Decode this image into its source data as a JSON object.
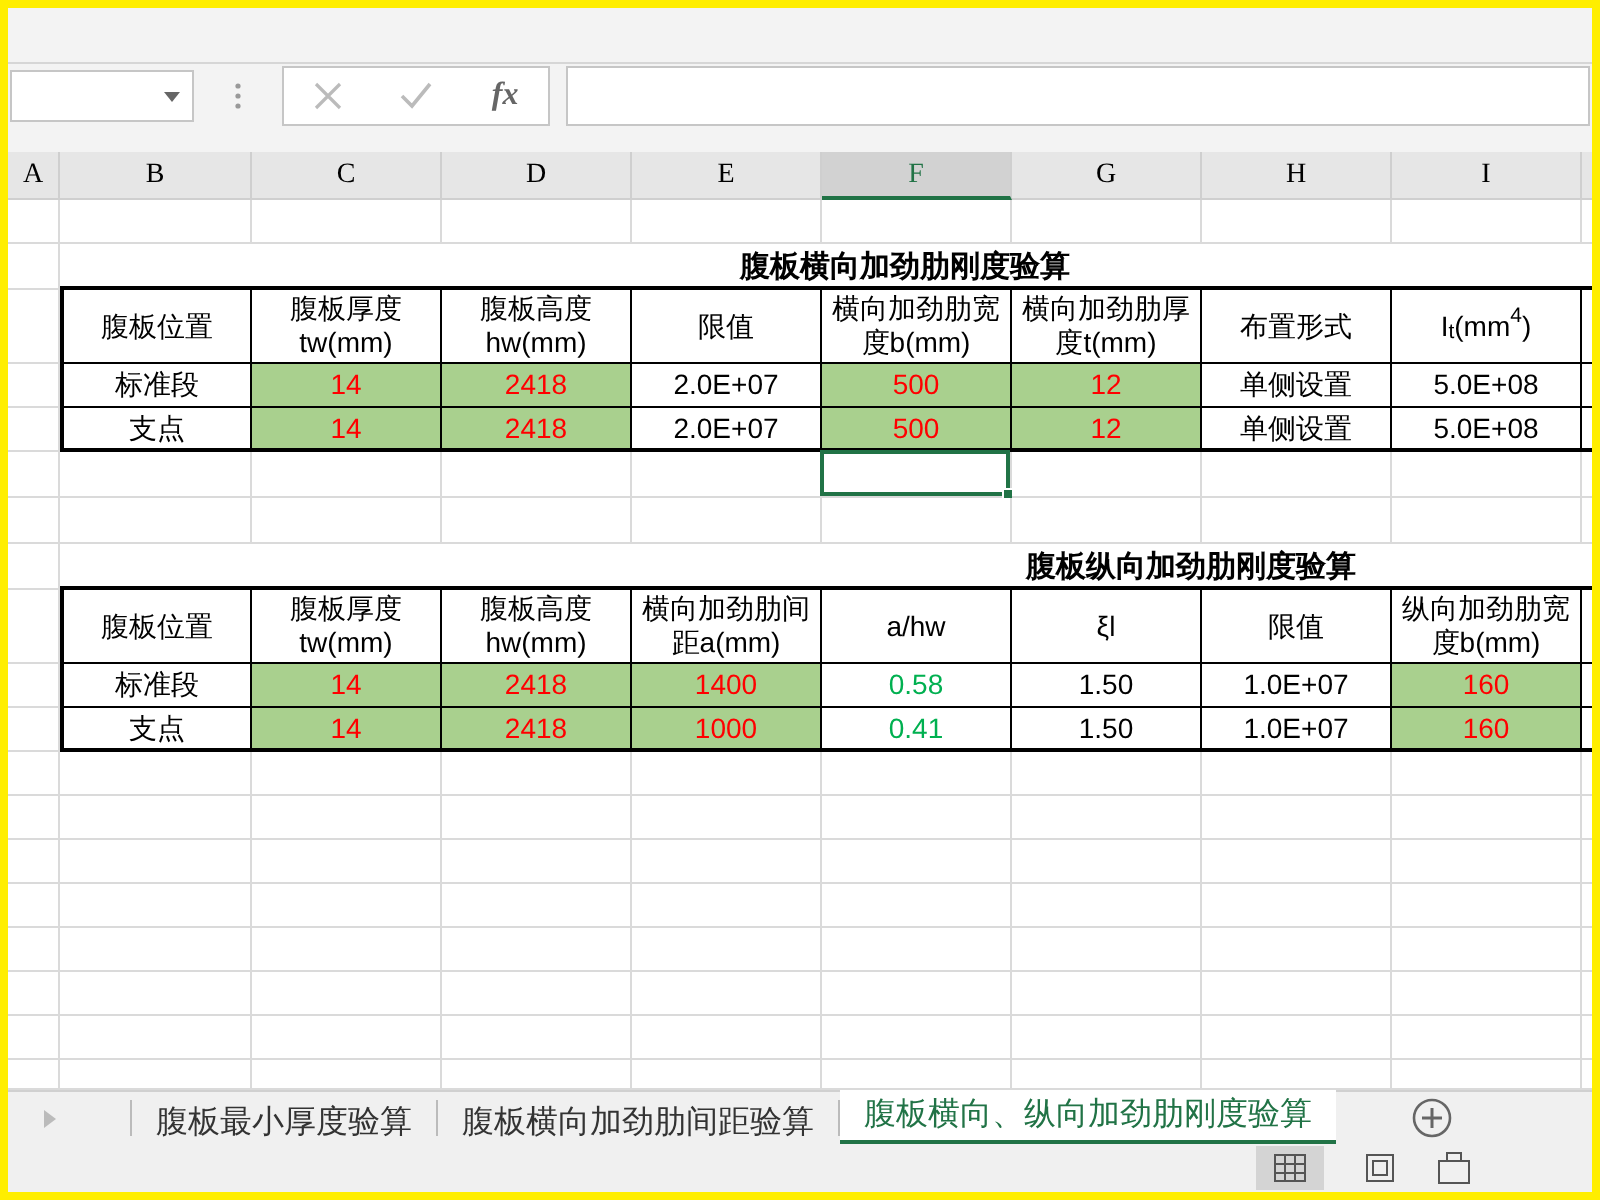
{
  "formula_bar": {
    "function_label": "fx"
  },
  "columns": [
    {
      "label": "A",
      "selected": false
    },
    {
      "label": "B",
      "selected": false
    },
    {
      "label": "C",
      "selected": false
    },
    {
      "label": "D",
      "selected": false
    },
    {
      "label": "E",
      "selected": false
    },
    {
      "label": "F",
      "selected": true
    },
    {
      "label": "G",
      "selected": false
    },
    {
      "label": "H",
      "selected": false
    },
    {
      "label": "I",
      "selected": false
    }
  ],
  "tables": [
    {
      "title": "腹板横向加劲肋刚度验算",
      "header": [
        "腹板位置",
        "腹板厚度\ntw(mm)",
        "腹板高度\nhw(mm)",
        "限值",
        "横向加劲肋宽度b(mm)",
        "横向加劲肋厚度t(mm)",
        "布置形式",
        "I$_{t}$(mm$^{4}$)"
      ],
      "rows": [
        {
          "cells": [
            {
              "text": "标准段",
              "kind": "label"
            },
            {
              "text": "14",
              "kind": "input"
            },
            {
              "text": "2418",
              "kind": "input"
            },
            {
              "text": "2.0E+07",
              "kind": "label"
            },
            {
              "text": "500",
              "kind": "input"
            },
            {
              "text": "12",
              "kind": "input"
            },
            {
              "text": "单侧设置",
              "kind": "label"
            },
            {
              "text": "5.0E+08",
              "kind": "label"
            }
          ]
        },
        {
          "cells": [
            {
              "text": "支点",
              "kind": "label"
            },
            {
              "text": "14",
              "kind": "input"
            },
            {
              "text": "2418",
              "kind": "input"
            },
            {
              "text": "2.0E+07",
              "kind": "label"
            },
            {
              "text": "500",
              "kind": "input"
            },
            {
              "text": "12",
              "kind": "input"
            },
            {
              "text": "单侧设置",
              "kind": "label"
            },
            {
              "text": "5.0E+08",
              "kind": "label"
            }
          ]
        }
      ]
    },
    {
      "title": "腹板纵向加劲肋刚度验算",
      "header": [
        "腹板位置",
        "腹板厚度\ntw(mm)",
        "腹板高度\nhw(mm)",
        "横向加劲肋间距a(mm)",
        "a/hw",
        "ξl",
        "限值",
        "纵向加劲肋宽度b(mm)"
      ],
      "rows": [
        {
          "cells": [
            {
              "text": "标准段",
              "kind": "label"
            },
            {
              "text": "14",
              "kind": "input"
            },
            {
              "text": "2418",
              "kind": "input"
            },
            {
              "text": "1400",
              "kind": "input"
            },
            {
              "text": "0.58",
              "kind": "result"
            },
            {
              "text": "1.50",
              "kind": "label"
            },
            {
              "text": "1.0E+07",
              "kind": "label"
            },
            {
              "text": "160",
              "kind": "input"
            }
          ]
        },
        {
          "cells": [
            {
              "text": "支点",
              "kind": "label"
            },
            {
              "text": "14",
              "kind": "input"
            },
            {
              "text": "2418",
              "kind": "input"
            },
            {
              "text": "1000",
              "kind": "input"
            },
            {
              "text": "0.41",
              "kind": "result"
            },
            {
              "text": "1.50",
              "kind": "label"
            },
            {
              "text": "1.0E+07",
              "kind": "label"
            },
            {
              "text": "160",
              "kind": "input"
            }
          ]
        }
      ]
    }
  ],
  "sheet_tabs": [
    {
      "label": "腹板最小厚度验算",
      "selected": false
    },
    {
      "label": "腹板横向加劲肋间距验算",
      "selected": false
    },
    {
      "label": "腹板横向、纵向加劲肋刚度验算",
      "selected": true
    }
  ]
}
